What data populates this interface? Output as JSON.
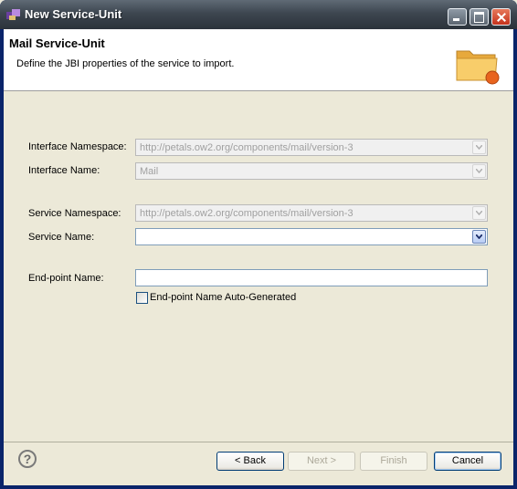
{
  "window": {
    "title": "New Service-Unit"
  },
  "banner": {
    "title": "Mail Service-Unit",
    "description": "Define the JBI properties of the service to import."
  },
  "form": {
    "interface_namespace": {
      "label": "Interface Namespace:",
      "value": "http://petals.ow2.org/components/mail/version-3",
      "enabled": false
    },
    "interface_name": {
      "label": "Interface Name:",
      "value": "Mail",
      "enabled": false
    },
    "service_namespace": {
      "label": "Service Namespace:",
      "value": "http://petals.ow2.org/components/mail/version-3",
      "enabled": false
    },
    "service_name": {
      "label": "Service Name:",
      "value": "",
      "enabled": true
    },
    "endpoint_name": {
      "label": "End-point Name:",
      "value": ""
    },
    "auto_generated": {
      "label": "End-point Name Auto-Generated",
      "checked": false
    }
  },
  "buttons": {
    "back": "< Back",
    "next": "Next >",
    "finish": "Finish",
    "cancel": "Cancel"
  },
  "icons": {
    "app": "eclipse-wizard-icon",
    "banner": "folder-icon",
    "help": "help-icon"
  },
  "colors": {
    "titlebar": "#3d4650",
    "close_button": "#c4331d",
    "dialog_bg": "#ece9d8",
    "folder": "#f6c35b",
    "folder_badge": "#e8641e"
  }
}
